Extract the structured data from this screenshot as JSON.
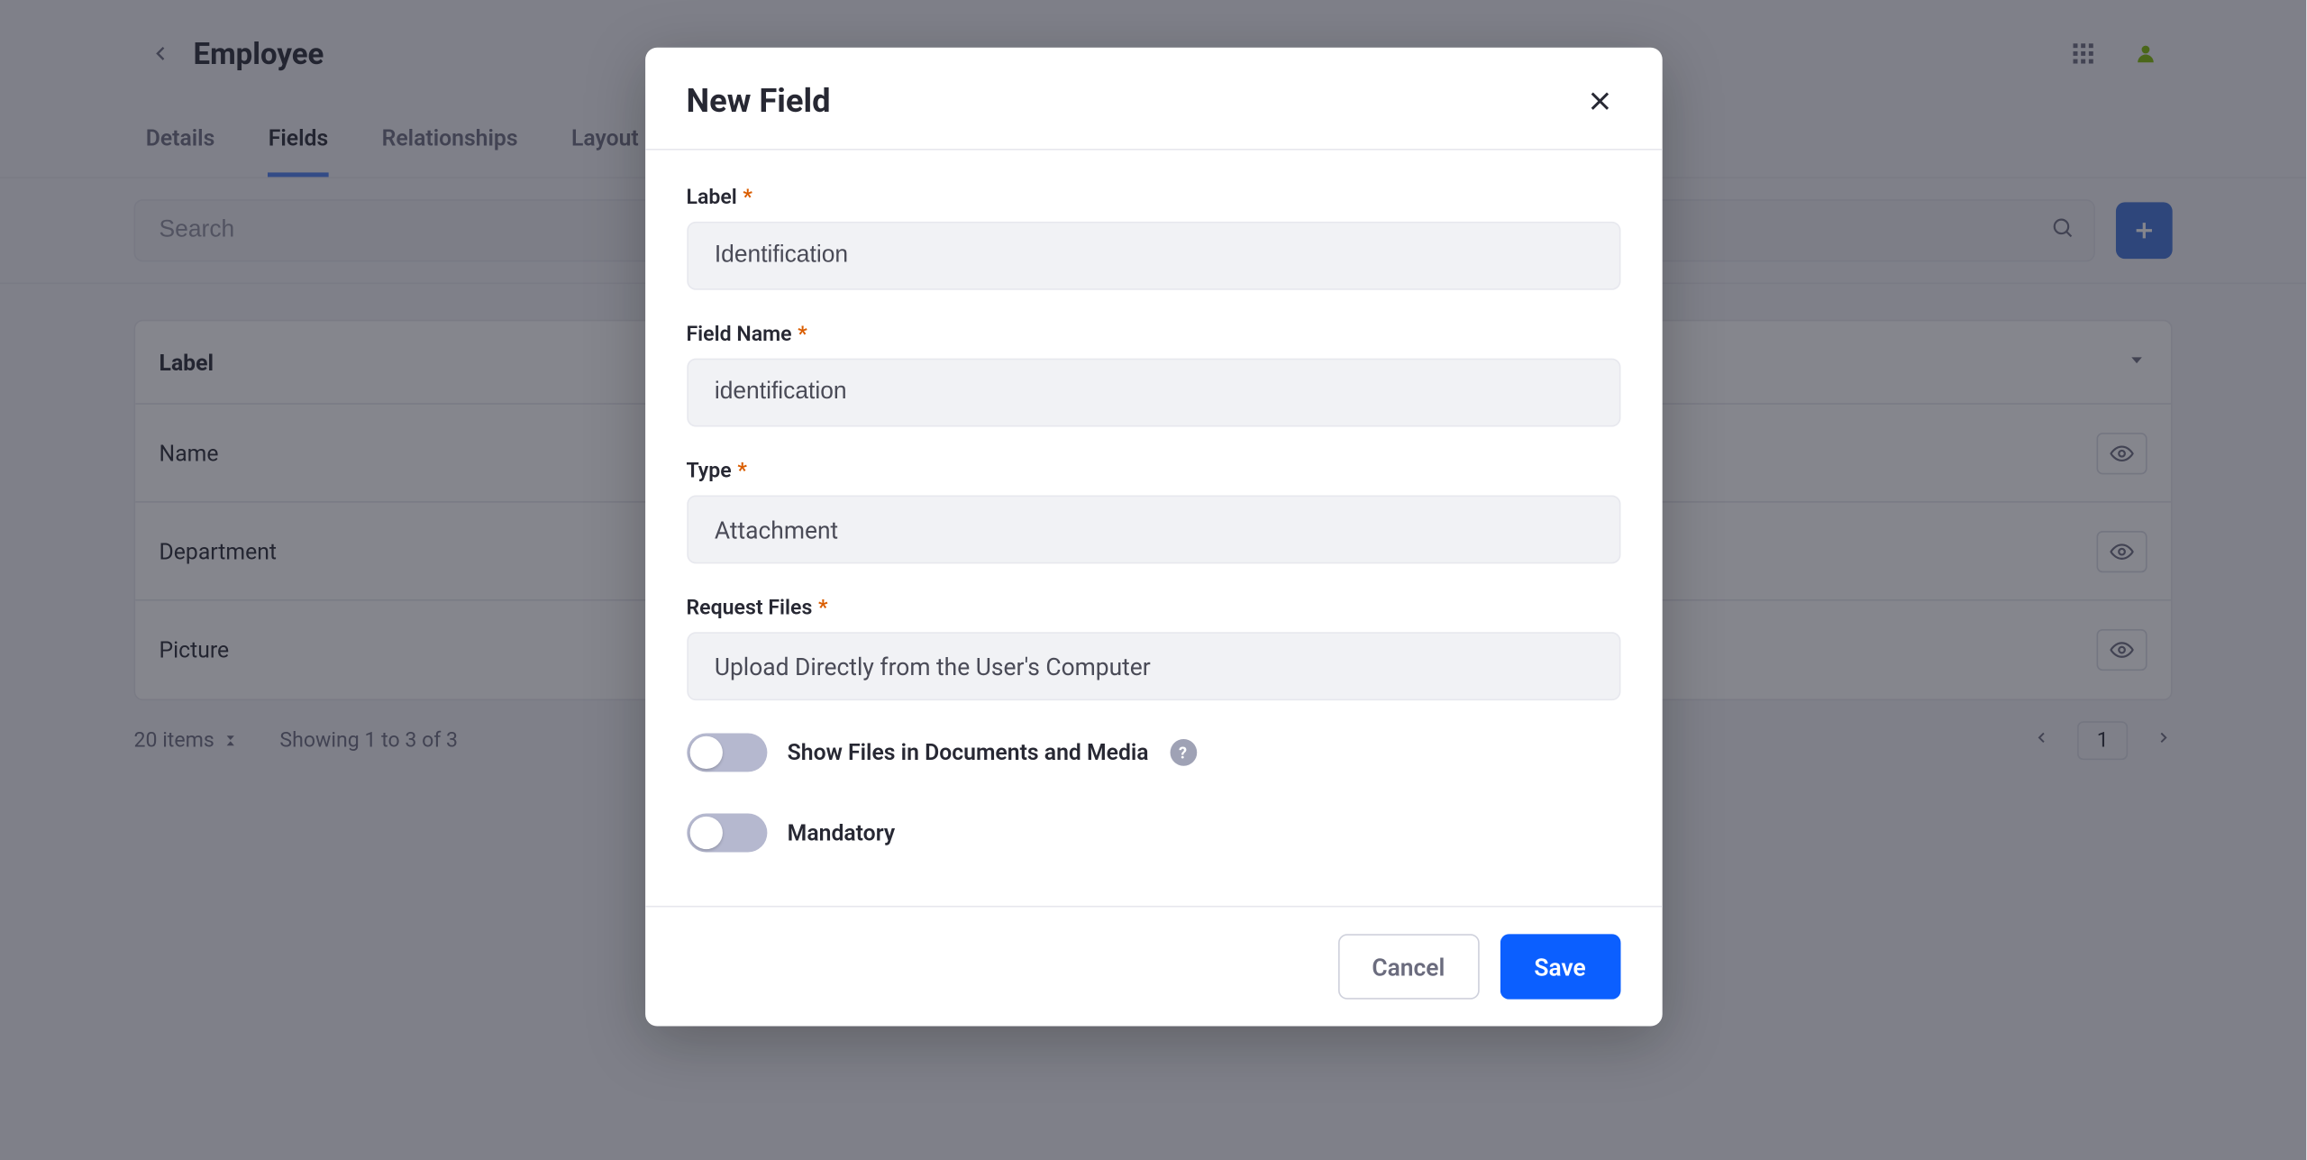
{
  "header": {
    "title": "Employee"
  },
  "tabs": {
    "items": [
      "Details",
      "Fields",
      "Relationships",
      "Layout"
    ],
    "active_index": 1
  },
  "search": {
    "placeholder": "Search"
  },
  "table": {
    "header_label": "Label",
    "rows": [
      {
        "label": "Name"
      },
      {
        "label": "Department"
      },
      {
        "label": "Picture"
      }
    ]
  },
  "pager": {
    "items_per_page": "20 items",
    "showing": "Showing 1 to 3 of 3",
    "page": "1"
  },
  "modal": {
    "title": "New Field",
    "fields": {
      "label_label": "Label",
      "label_value": "Identification",
      "fieldname_label": "Field Name",
      "fieldname_value": "identification",
      "type_label": "Type",
      "type_value": "Attachment",
      "requestfiles_label": "Request Files",
      "requestfiles_value": "Upload Directly from the User's Computer",
      "showfiles_label": "Show Files in Documents and Media",
      "mandatory_label": "Mandatory"
    },
    "buttons": {
      "cancel": "Cancel",
      "save": "Save"
    }
  }
}
